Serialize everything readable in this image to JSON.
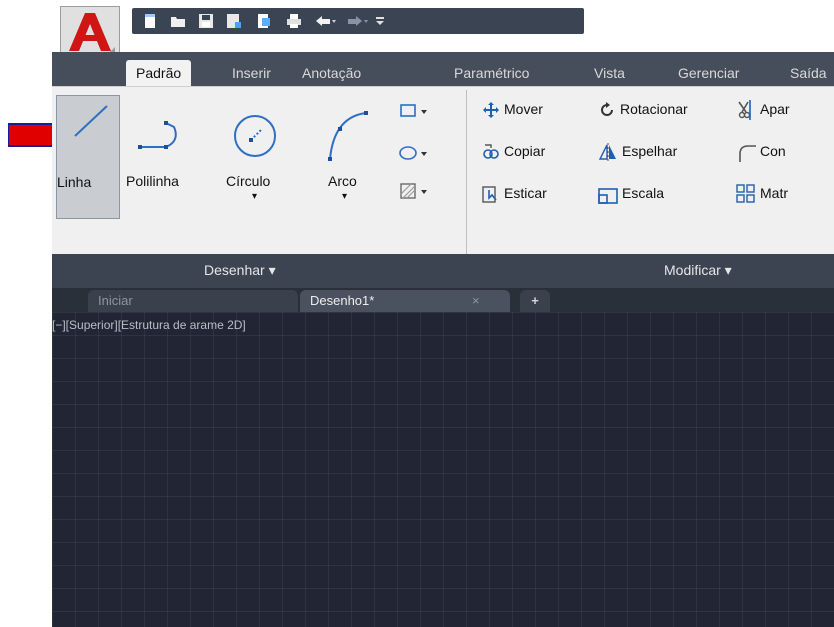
{
  "qat": {
    "icons": [
      "new-icon",
      "open-icon",
      "save-icon",
      "save-as-icon",
      "publish-icon",
      "print-icon",
      "undo-icon",
      "redo-icon",
      "customize-icon"
    ]
  },
  "tabs": [
    "Padrão",
    "Inserir",
    "Anotação",
    "Paramétrico",
    "Vista",
    "Gerenciar",
    "Saída"
  ],
  "draw": {
    "linha": "Linha",
    "polilinha": "Polilinha",
    "circulo": "Círculo",
    "arco": "Arco",
    "panel_title": "Desenhar ▾"
  },
  "modify": {
    "mover": "Mover",
    "rotacionar": "Rotacionar",
    "aparar": "Apar",
    "copiar": "Copiar",
    "espelhar": "Espelhar",
    "con": "Con",
    "esticar": "Esticar",
    "escala": "Escala",
    "matriz": "Matr",
    "panel_title": "Modificar ▾"
  },
  "doc_tabs": {
    "start": "Iniciar",
    "current": "Desenho1*",
    "close": "×",
    "new": "+"
  },
  "viewport": {
    "label": "[−][Superior][Estrutura de arame 2D]"
  },
  "colors": {
    "ribbon_dark": "#464e5c",
    "canvas": "#222634",
    "accent_red": "#e00000"
  }
}
